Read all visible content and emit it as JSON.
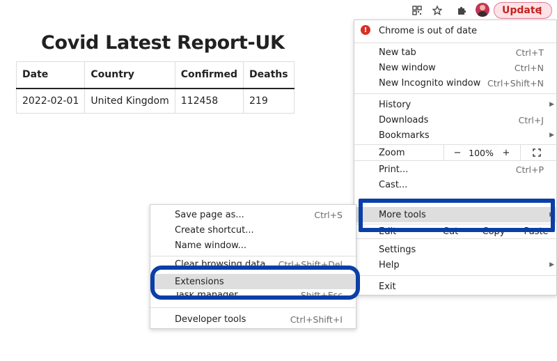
{
  "toolbar": {
    "icons": [
      "qr-code-icon",
      "star-icon",
      "extensions-puzzle-icon",
      "profile-avatar"
    ],
    "update_label": "Update",
    "accent_color": "#c5221f"
  },
  "report": {
    "title": "Covid Latest Report-UK",
    "columns": [
      "Date",
      "Country",
      "Confirmed",
      "Deaths"
    ],
    "rows": [
      [
        "2022-02-01",
        "United Kingdom",
        "112458",
        "219"
      ]
    ]
  },
  "main_menu": {
    "out_of_date": "Chrome is out of date",
    "new_tab": {
      "label": "New tab",
      "shortcut": "Ctrl+T"
    },
    "new_window": {
      "label": "New window",
      "shortcut": "Ctrl+N"
    },
    "new_incognito": {
      "label": "New Incognito window",
      "shortcut": "Ctrl+Shift+N"
    },
    "history": {
      "label": "History"
    },
    "downloads": {
      "label": "Downloads",
      "shortcut": "Ctrl+J"
    },
    "bookmarks": {
      "label": "Bookmarks"
    },
    "zoom": {
      "label": "Zoom",
      "minus": "−",
      "value": "100%",
      "plus": "+"
    },
    "print": {
      "label": "Print...",
      "shortcut": "Ctrl+P"
    },
    "cast": {
      "label": "Cast..."
    },
    "more_tools": {
      "label": "More tools"
    },
    "edit": {
      "label": "Edit",
      "cut": "Cut",
      "copy": "Copy",
      "paste": "Paste"
    },
    "settings": {
      "label": "Settings"
    },
    "help": {
      "label": "Help"
    },
    "exit": {
      "label": "Exit"
    }
  },
  "sub_menu": {
    "save_page": {
      "label": "Save page as...",
      "shortcut": "Ctrl+S"
    },
    "create_shortcut": {
      "label": "Create shortcut..."
    },
    "name_window": {
      "label": "Name window..."
    },
    "clear_data": {
      "label": "Clear browsing data...",
      "shortcut": "Ctrl+Shift+Del"
    },
    "extensions": {
      "label": "Extensions"
    },
    "task_manager": {
      "label": "Task manager",
      "shortcut": "Shift+Esc"
    },
    "developer_tools": {
      "label": "Developer tools",
      "shortcut": "Ctrl+Shift+I"
    }
  },
  "annotation": {
    "color": "#0b3fa8"
  }
}
